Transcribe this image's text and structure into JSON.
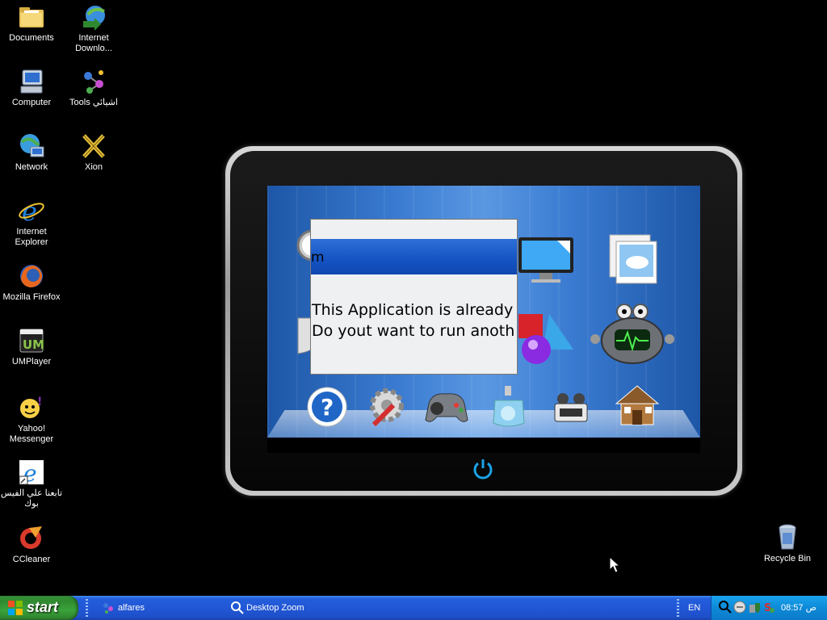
{
  "desktop": {
    "icons_left": [
      {
        "label": "Documents",
        "icon": "folder-icon"
      },
      {
        "label": "Computer",
        "icon": "computer-icon"
      },
      {
        "label": "Network",
        "icon": "network-icon"
      },
      {
        "label": "Internet Explorer",
        "icon": "ie-icon"
      },
      {
        "label": "Mozilla Firefox",
        "icon": "firefox-icon"
      },
      {
        "label": "UMPlayer",
        "icon": "umplayer-icon"
      },
      {
        "label": "Yahoo! Messenger",
        "icon": "yahoo-icon"
      },
      {
        "label": "تابعنا علي الفيس بوك",
        "icon": "ie-link-icon"
      },
      {
        "label": "CCleaner",
        "icon": "ccleaner-icon"
      }
    ],
    "icons_right": [
      {
        "label": "Internet Downlo...",
        "icon": "idm-icon"
      },
      {
        "label": "Tools اشيائي",
        "icon": "tools-icon"
      },
      {
        "label": "Xion",
        "icon": "xion-icon"
      }
    ],
    "recycle_bin": {
      "label": "Recycle Bin",
      "icon": "recycle-bin-icon"
    }
  },
  "dialog": {
    "title": "m",
    "line1": "This Application is already r",
    "line2": "Do yout want to run anoth"
  },
  "tablet": {
    "apps_top": [
      "clock-icon",
      "pictures-icon",
      "monitor-icon",
      "photo-viewer-icon"
    ],
    "apps_mid": [
      "shield-icon",
      "shapes-icon",
      "robot-icon"
    ],
    "dock": [
      "help-icon",
      "settings-icon",
      "gamepad-icon",
      "perfume-icon",
      "projector-icon",
      "home-icon"
    ],
    "power_icon": "power-icon"
  },
  "taskbar": {
    "start_label": "start",
    "items": [
      {
        "label": "alfares",
        "icon": "alfares-icon"
      },
      {
        "label": "Desktop Zoom",
        "icon": "magnifier-icon"
      }
    ],
    "language": "EN",
    "clock": "08:57 ص"
  },
  "colors": {
    "taskbar_blue": "#245edb",
    "start_green": "#3aa33a",
    "tray_blue": "#0d8ad8",
    "dialog_title_blue": "#1453c2"
  }
}
